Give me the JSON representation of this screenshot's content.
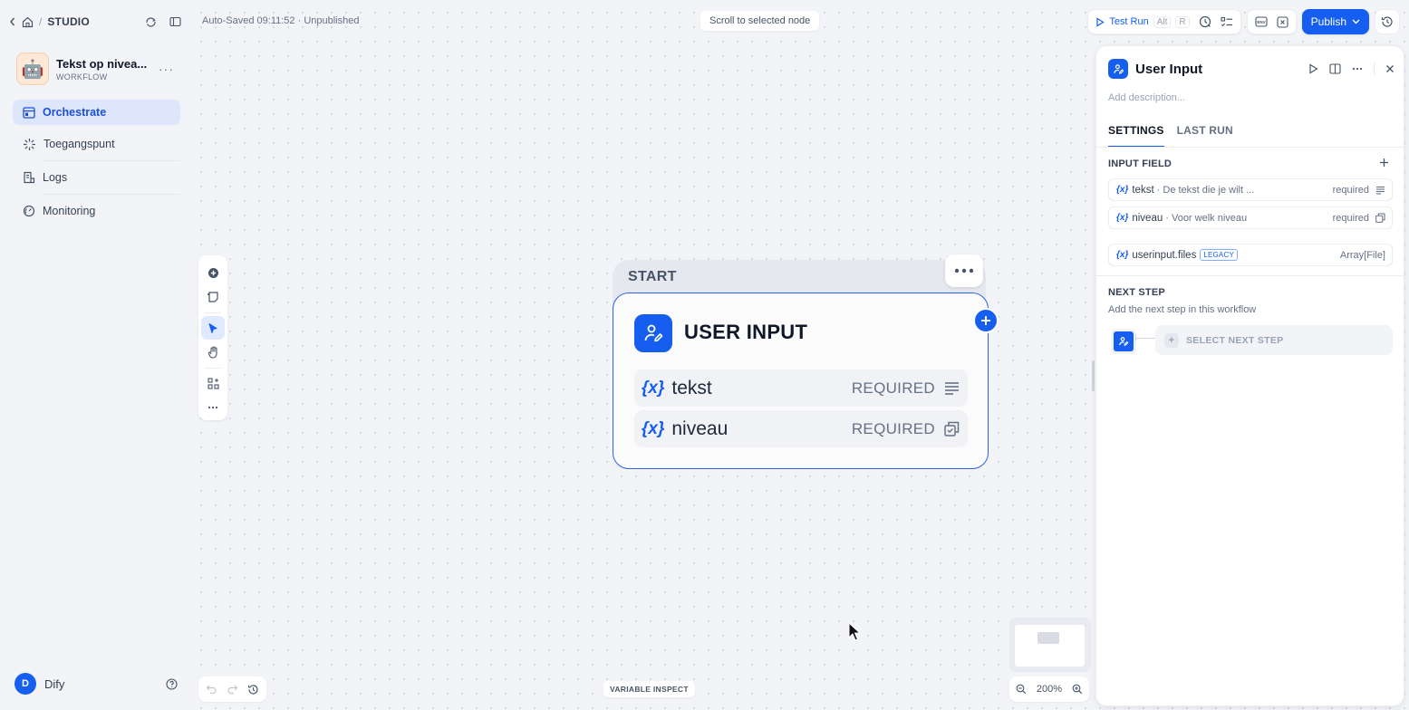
{
  "nav": {
    "home_label": "STUDIO"
  },
  "app": {
    "name": "Tekst op nivea...",
    "type": "WORKFLOW",
    "avatar": "🤖"
  },
  "sidebar": {
    "items": [
      {
        "label": "Orchestrate",
        "icon": "layout-icon",
        "active": true
      },
      {
        "label": "Toegangspunt",
        "icon": "access-point-icon",
        "active": false
      },
      {
        "label": "Logs",
        "icon": "logs-icon",
        "active": false
      },
      {
        "label": "Monitoring",
        "icon": "monitoring-icon",
        "active": false
      }
    ]
  },
  "user": {
    "initial": "D",
    "name": "Dify"
  },
  "header": {
    "status": "Auto-Saved 09:11:52 · Unpublished",
    "scroll_button": "Scroll to selected node",
    "test_run": "Test Run",
    "test_run_kbd_1": "Alt",
    "test_run_kbd_2": "R",
    "publish": "Publish"
  },
  "canvas": {
    "variable_inspect": "VARIABLE INSPECT",
    "zoom": "200%"
  },
  "node": {
    "start_label": "START",
    "title": "USER INPUT",
    "fields": [
      {
        "var": "{x}",
        "name": "tekst",
        "req": "REQUIRED",
        "type_icon": "paragraph-icon"
      },
      {
        "var": "{x}",
        "name": "niveau",
        "req": "REQUIRED",
        "type_icon": "select-icon"
      }
    ]
  },
  "panel": {
    "title": "User Input",
    "description_placeholder": "Add description...",
    "tabs": [
      {
        "label": "SETTINGS",
        "active": true
      },
      {
        "label": "LAST RUN",
        "active": false
      }
    ],
    "input_field_label": "INPUT FIELD",
    "fields": [
      {
        "var": "{x}",
        "name": "tekst",
        "desc": "· De tekst die je wilt ...",
        "req": "required"
      },
      {
        "var": "{x}",
        "name": "niveau",
        "desc": "· Voor welk niveau",
        "req": "required"
      }
    ],
    "legacy_field": {
      "var": "{x}",
      "name": "userinput.files",
      "badge": "LEGACY",
      "type": "Array[File]"
    },
    "next_step_label": "NEXT STEP",
    "next_step_sub": "Add the next step in this workflow",
    "select_next": "SELECT NEXT STEP"
  },
  "colors": {
    "accent": "#155eef",
    "active_nav_bg": "#dde6fb"
  }
}
